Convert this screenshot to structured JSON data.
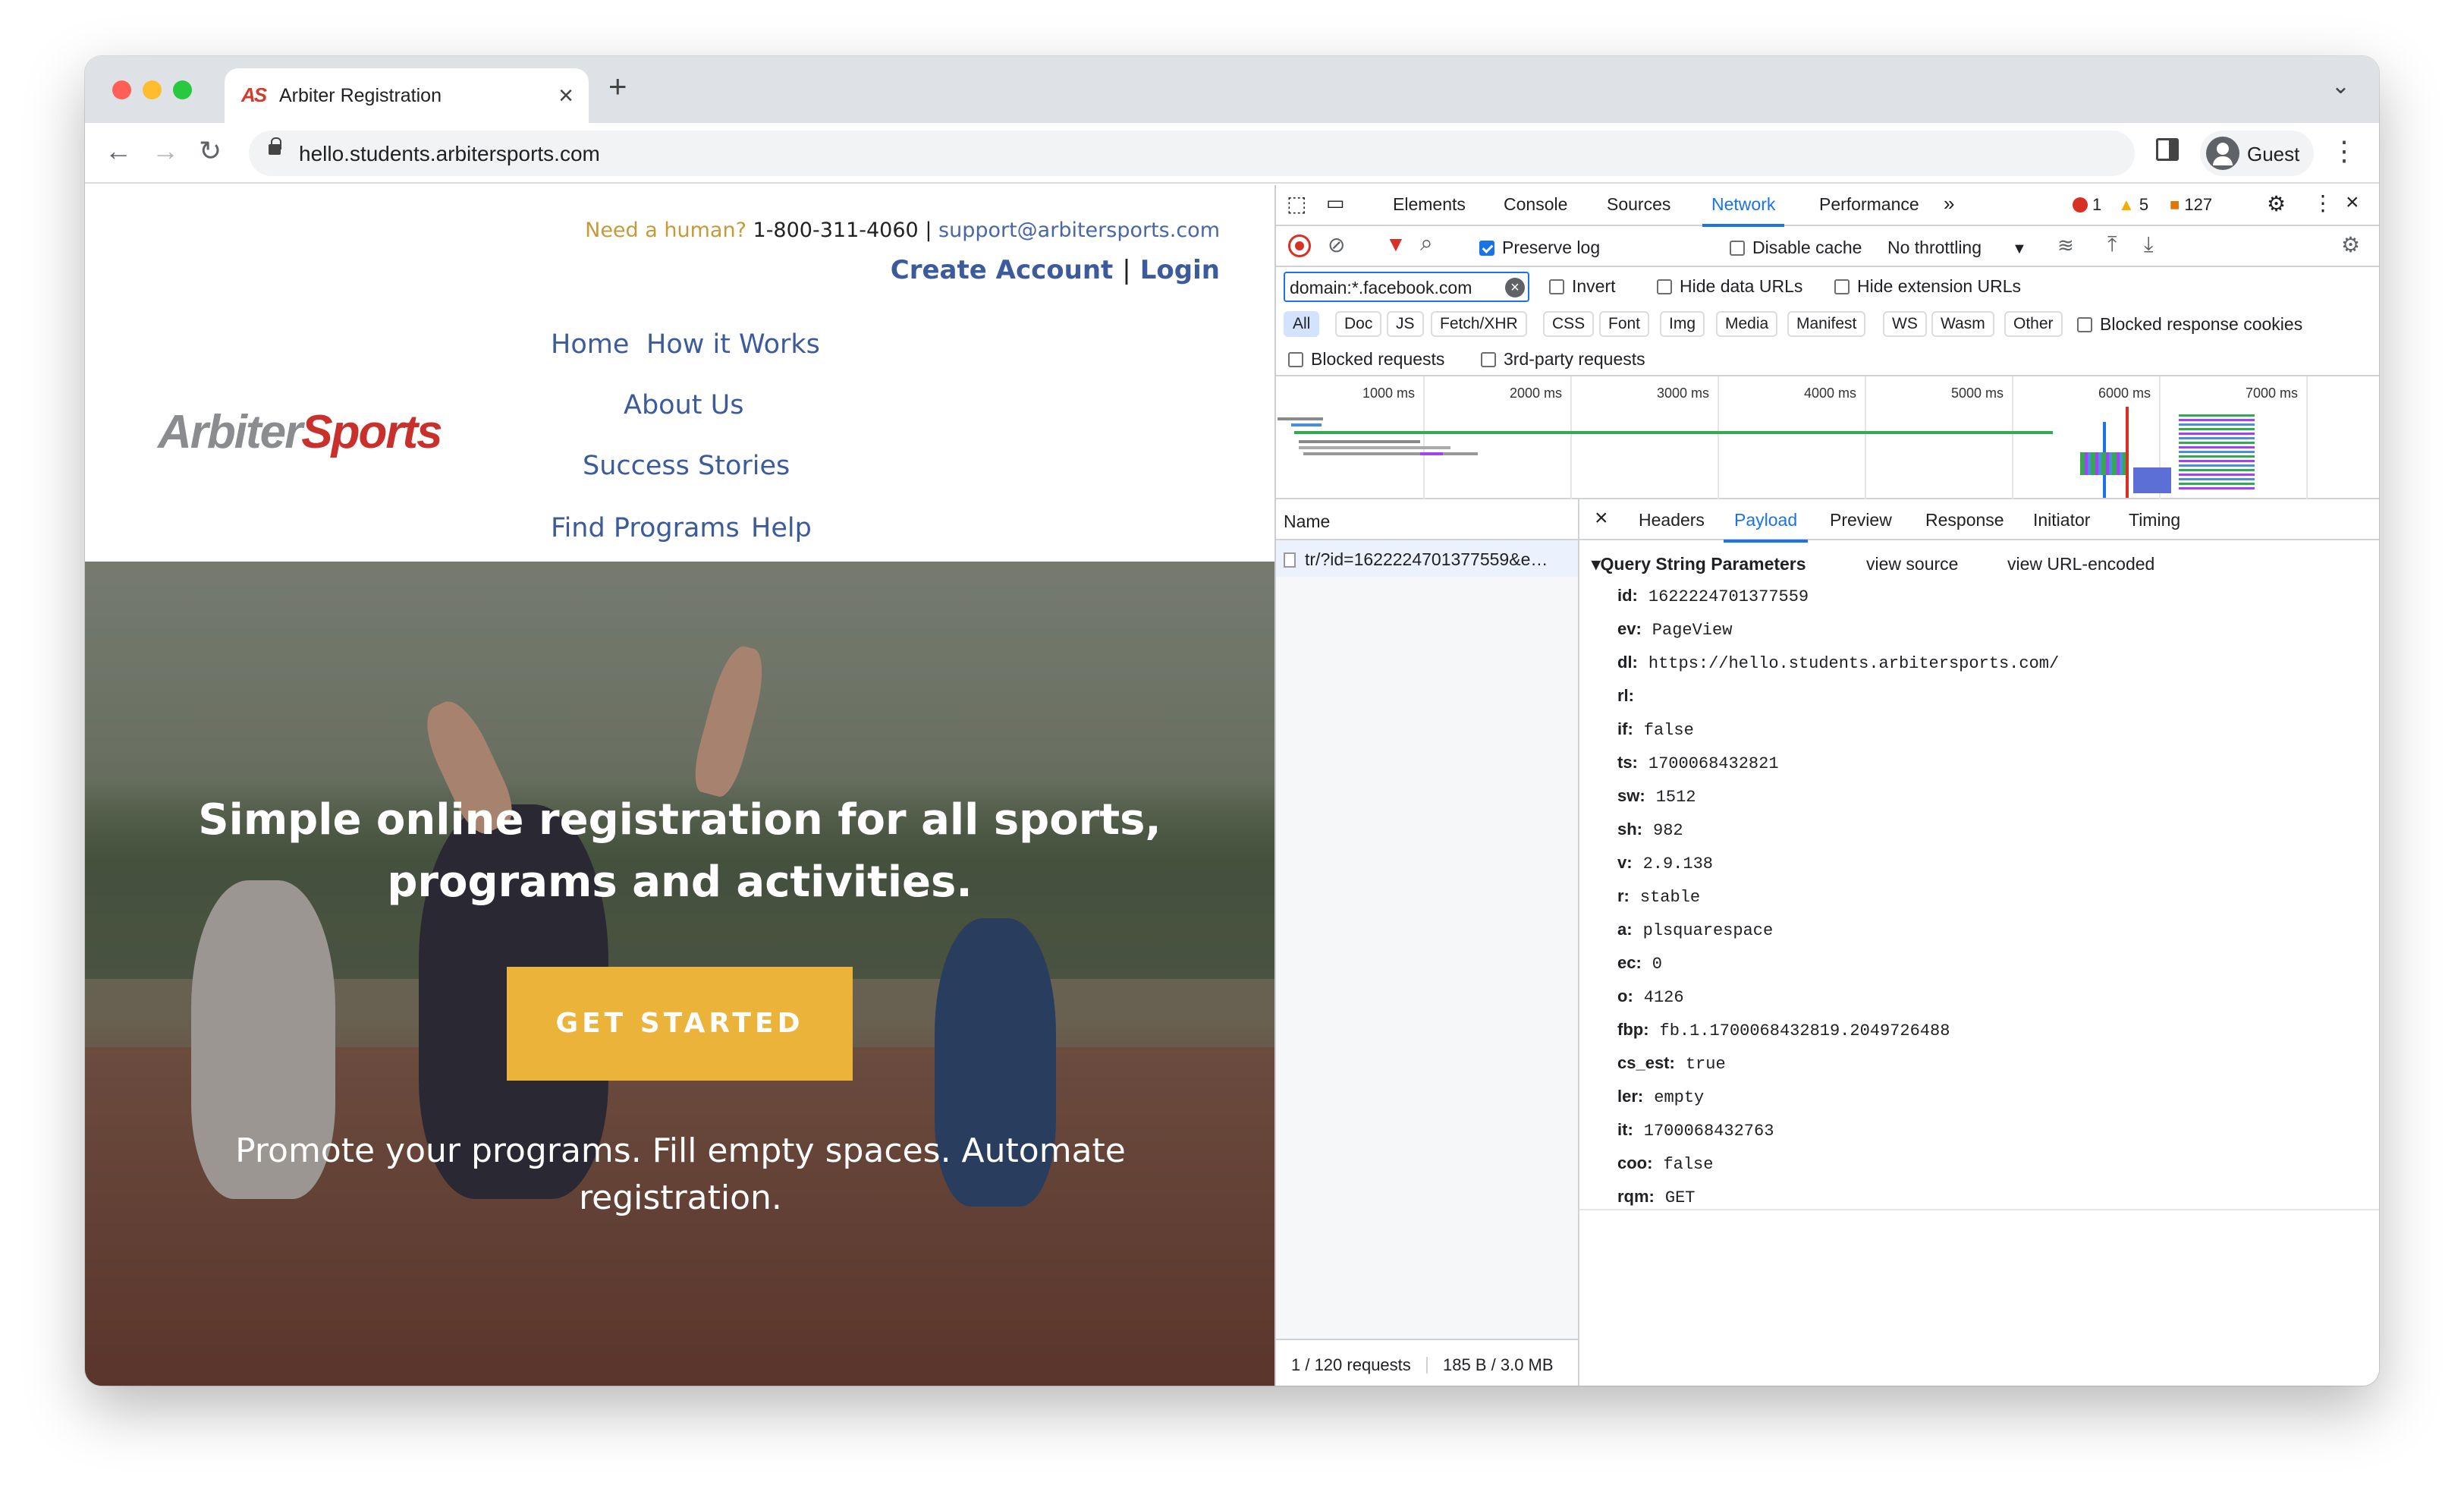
{
  "browser": {
    "tab_title": "Arbiter Registration",
    "tab_favicon": "AS",
    "url": "hello.students.arbitersports.com",
    "profile_label": "Guest",
    "colors": {
      "tabstrip": "#dee1e6",
      "close": "#ff5f57",
      "minimize": "#febc2e",
      "maximize": "#28c840"
    }
  },
  "site": {
    "need_human": "Need a human?",
    "phone": "1-800-311-4060",
    "divider": "|",
    "email": "support@arbitersports.com",
    "create_account": "Create Account",
    "login": "Login",
    "logo_arbiter": "Arbiter",
    "logo_sports": "Sports",
    "nav": {
      "home": "Home",
      "how_it_works": "How it Works",
      "about_us": "About Us",
      "success_stories": "Success Stories",
      "find_programs": "Find Programs",
      "help": "Help"
    },
    "hero_headline_line1": "Simple online registration for all sports,",
    "hero_headline_line2": "programs and activities.",
    "cta": "GET STARTED",
    "hero_sub": "Promote your programs. Fill empty spaces. Automate registration.",
    "colors": {
      "nav": "#3c5b9c",
      "cta": "#ebb33a",
      "need_human": "#c59a3a",
      "logo_red": "#c9302c"
    }
  },
  "devtools": {
    "tabs": [
      "Elements",
      "Console",
      "Sources",
      "Network",
      "Performance"
    ],
    "active_tab": "Network",
    "errors": "1",
    "warnings": "5",
    "issues": "127",
    "preserve_log": "Preserve log",
    "disable_cache": "Disable cache",
    "throttling": "No throttling",
    "filter_value": "domain:*.facebook.com",
    "invert": "Invert",
    "hide_data_urls": "Hide data URLs",
    "hide_extension_urls": "Hide extension URLs",
    "type_filters": [
      "All",
      "Doc",
      "JS",
      "Fetch/XHR",
      "CSS",
      "Font",
      "Img",
      "Media",
      "Manifest",
      "WS",
      "Wasm",
      "Other"
    ],
    "blocked_response_cookies": "Blocked response cookies",
    "blocked_requests": "Blocked requests",
    "third_party": "3rd-party requests",
    "timeline_ticks": [
      "1000 ms",
      "2000 ms",
      "3000 ms",
      "4000 ms",
      "5000 ms",
      "6000 ms",
      "7000 ms"
    ],
    "name_header": "Name",
    "request_name": "tr/?id=1622224701377559&e…",
    "status_requests": "1 / 120 requests",
    "status_size": "185 B / 3.0 MB",
    "detail_tabs": [
      "Headers",
      "Payload",
      "Preview",
      "Response",
      "Initiator",
      "Timing"
    ],
    "active_detail_tab": "Payload",
    "section_title": "Query String Parameters",
    "view_source": "view source",
    "view_url_encoded": "view URL-encoded",
    "params": [
      {
        "key": "id:",
        "value": "1622224701377559"
      },
      {
        "key": "ev:",
        "value": "PageView"
      },
      {
        "key": "dl:",
        "value": "https://hello.students.arbitersports.com/"
      },
      {
        "key": "rl:",
        "value": ""
      },
      {
        "key": "if:",
        "value": "false"
      },
      {
        "key": "ts:",
        "value": "1700068432821"
      },
      {
        "key": "sw:",
        "value": "1512"
      },
      {
        "key": "sh:",
        "value": "982"
      },
      {
        "key": "v:",
        "value": "2.9.138"
      },
      {
        "key": "r:",
        "value": "stable"
      },
      {
        "key": "a:",
        "value": "plsquarespace"
      },
      {
        "key": "ec:",
        "value": "0"
      },
      {
        "key": "o:",
        "value": "4126"
      },
      {
        "key": "fbp:",
        "value": "fb.1.1700068432819.2049726488"
      },
      {
        "key": "cs_est:",
        "value": "true"
      },
      {
        "key": "ler:",
        "value": "empty"
      },
      {
        "key": "it:",
        "value": "1700068432763"
      },
      {
        "key": "coo:",
        "value": "false"
      },
      {
        "key": "rqm:",
        "value": "GET"
      }
    ],
    "colors": {
      "accent": "#1a73e8",
      "error": "#d93025",
      "warning": "#f9ab00",
      "issue": "#e37400"
    }
  }
}
